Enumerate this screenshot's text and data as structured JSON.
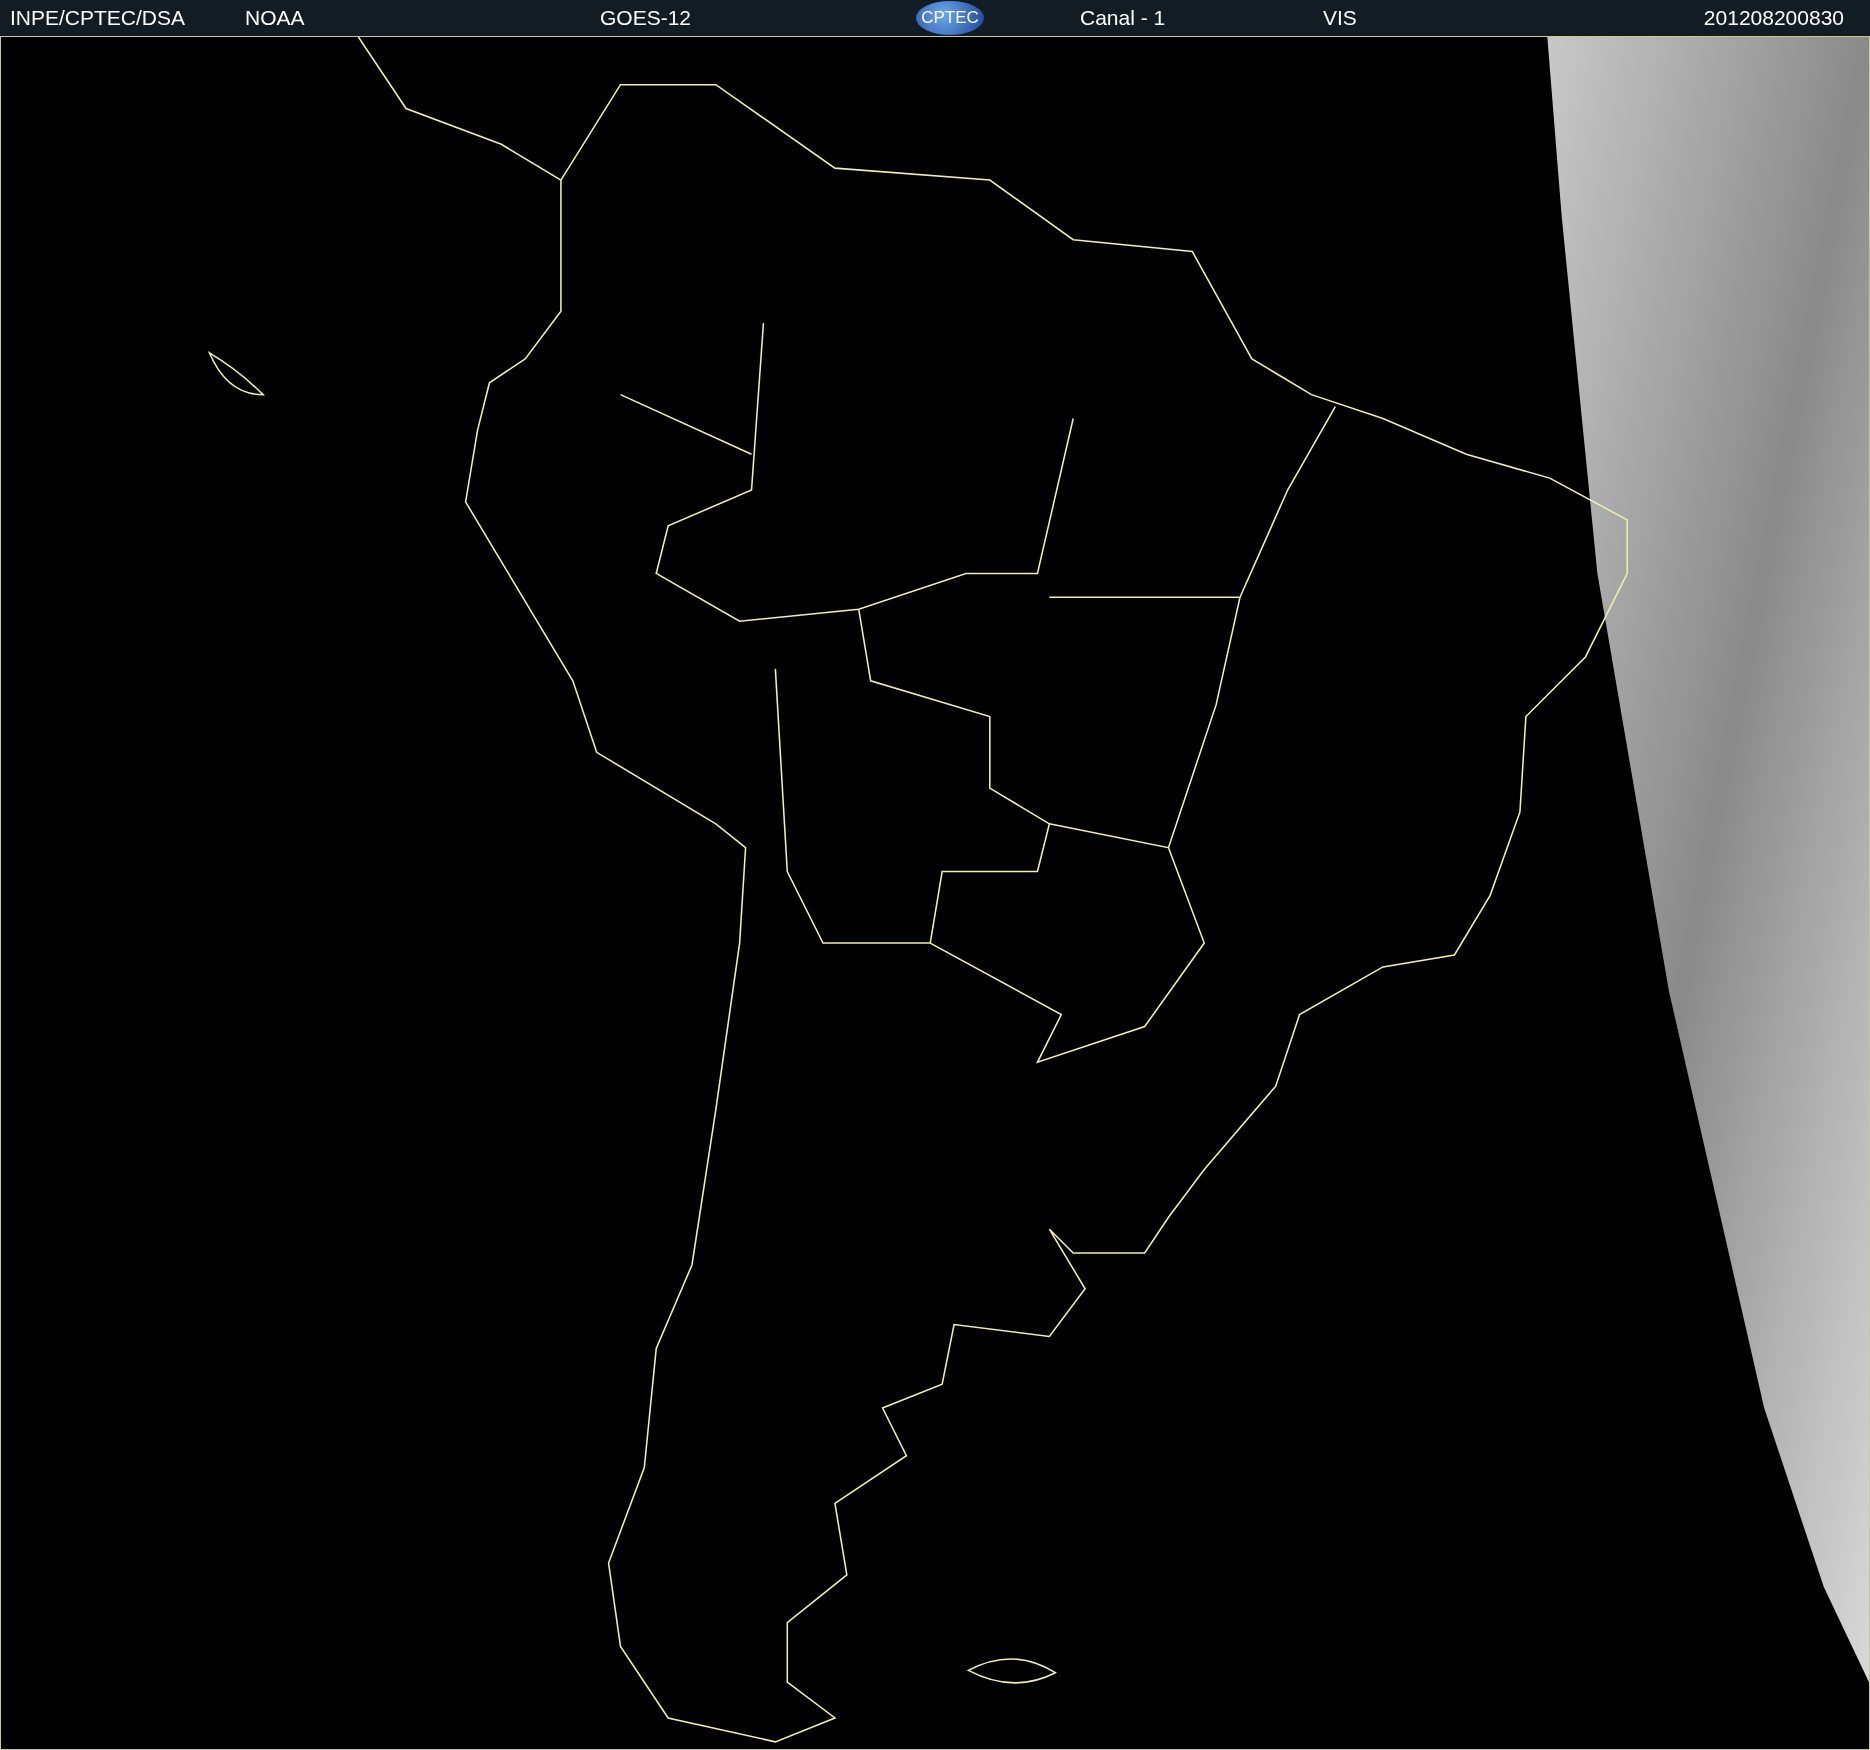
{
  "header": {
    "source": "INPE/CPTEC/DSA",
    "agency": "NOAA",
    "satellite": "GOES-12",
    "logo_text": "CPTEC",
    "channel": "Canal - 1",
    "band": "VIS",
    "timestamp": "201208200830"
  }
}
